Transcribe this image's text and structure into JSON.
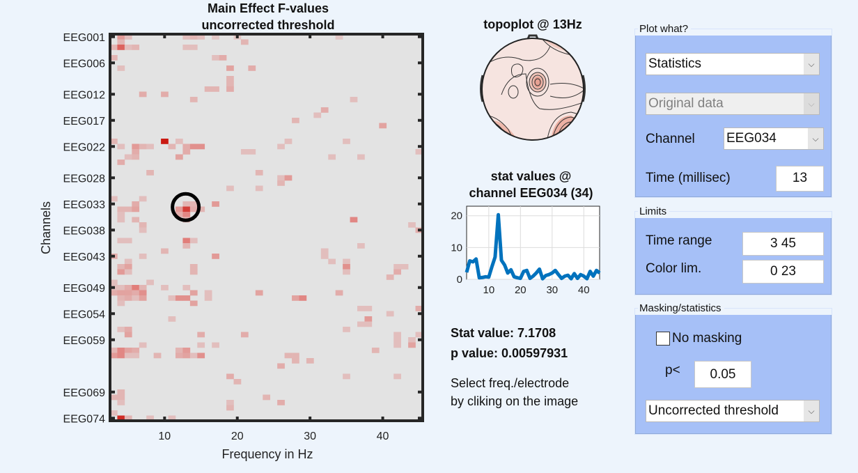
{
  "chart_data": [
    {
      "type": "heatmap",
      "title": "Main Effect F-values",
      "subtitle": "uncorrected threshold",
      "xlabel": "Frequency in Hz",
      "ylabel": "Channels",
      "xlim": [
        3,
        45
      ],
      "x_ticks": [
        10,
        20,
        30,
        40
      ],
      "n_channels": 74,
      "y_tick_labels": [
        {
          "label": "EEG001",
          "channel": 1
        },
        {
          "label": "EEG006",
          "channel": 6
        },
        {
          "label": "EEG012",
          "channel": 12
        },
        {
          "label": "EEG017",
          "channel": 17
        },
        {
          "label": "EEG022",
          "channel": 22
        },
        {
          "label": "EEG028",
          "channel": 28
        },
        {
          "label": "EEG033",
          "channel": 33
        },
        {
          "label": "EEG038",
          "channel": 38
        },
        {
          "label": "EEG043",
          "channel": 43
        },
        {
          "label": "EEG049",
          "channel": 49
        },
        {
          "label": "EEG054",
          "channel": 54
        },
        {
          "label": "EEG059",
          "channel": 59
        },
        {
          "label": "EEG069",
          "channel": 69
        },
        {
          "label": "EEG074",
          "channel": 74
        }
      ],
      "clim": [
        0,
        23
      ],
      "colormap": [
        "#e3e3e3",
        "#c00000"
      ],
      "selected_point": {
        "freq": 13,
        "channel": 34
      },
      "cells_freq_channel_value": [
        [
          4,
          1,
          8
        ],
        [
          5,
          1,
          4
        ],
        [
          13,
          1,
          4
        ],
        [
          14,
          1,
          5
        ],
        [
          15,
          1,
          4
        ],
        [
          17,
          1,
          3
        ],
        [
          20,
          1,
          3
        ],
        [
          34,
          1,
          3
        ],
        [
          4,
          2,
          5
        ],
        [
          21,
          2,
          5
        ],
        [
          3,
          3,
          5
        ],
        [
          4,
          3,
          14
        ],
        [
          5,
          3,
          4
        ],
        [
          6,
          3,
          5
        ],
        [
          13,
          3,
          4
        ],
        [
          14,
          3,
          4
        ],
        [
          3,
          5,
          5
        ],
        [
          17,
          5,
          4
        ],
        [
          18,
          5,
          6
        ],
        [
          4,
          7,
          4
        ],
        [
          19,
          7,
          7
        ],
        [
          22,
          7,
          6
        ],
        [
          19,
          9,
          5
        ],
        [
          19,
          10,
          5
        ],
        [
          16,
          11,
          5
        ],
        [
          17,
          11,
          5
        ],
        [
          19,
          11,
          6
        ],
        [
          7,
          12,
          6
        ],
        [
          10,
          12,
          6
        ],
        [
          14,
          13,
          5
        ],
        [
          36,
          13,
          4
        ],
        [
          32,
          15,
          6
        ],
        [
          31,
          16,
          4
        ],
        [
          28,
          17,
          5
        ],
        [
          40,
          18,
          7
        ],
        [
          3,
          21,
          5
        ],
        [
          10,
          21,
          22
        ],
        [
          12,
          21,
          4
        ],
        [
          27,
          21,
          4
        ],
        [
          35,
          21,
          4
        ],
        [
          4,
          22,
          4
        ],
        [
          6,
          22,
          8
        ],
        [
          7,
          22,
          5
        ],
        [
          8,
          22,
          4
        ],
        [
          11,
          22,
          5
        ],
        [
          13,
          22,
          6
        ],
        [
          14,
          22,
          9
        ],
        [
          15,
          22,
          9
        ],
        [
          26,
          22,
          4
        ],
        [
          6,
          23,
          6
        ],
        [
          13,
          23,
          6
        ],
        [
          21,
          23,
          4
        ],
        [
          22,
          23,
          4
        ],
        [
          45,
          23,
          4
        ],
        [
          5,
          24,
          4
        ],
        [
          6,
          24,
          5
        ],
        [
          12,
          24,
          7
        ],
        [
          33,
          24,
          4
        ],
        [
          37,
          24,
          4
        ],
        [
          4,
          25,
          6
        ],
        [
          8,
          27,
          5
        ],
        [
          23,
          27,
          5
        ],
        [
          26,
          28,
          4
        ],
        [
          27,
          28,
          8
        ],
        [
          26,
          29,
          5
        ],
        [
          19,
          30,
          4
        ],
        [
          23,
          30,
          4
        ],
        [
          3,
          32,
          4
        ],
        [
          7,
          32,
          4
        ],
        [
          6,
          33,
          6
        ],
        [
          13,
          33,
          5
        ],
        [
          14,
          33,
          5
        ],
        [
          17,
          33,
          8
        ],
        [
          4,
          34,
          5
        ],
        [
          5,
          34,
          5
        ],
        [
          6,
          34,
          7
        ],
        [
          12,
          34,
          8
        ],
        [
          13,
          34,
          18
        ],
        [
          14,
          34,
          6
        ],
        [
          15,
          34,
          5
        ],
        [
          4,
          35,
          4
        ],
        [
          12,
          35,
          6
        ],
        [
          13,
          35,
          10
        ],
        [
          4,
          36,
          4
        ],
        [
          6,
          36,
          5
        ],
        [
          13,
          36,
          5
        ],
        [
          36,
          36,
          10
        ],
        [
          7,
          37,
          5
        ],
        [
          44,
          37,
          4
        ],
        [
          7,
          38,
          4
        ],
        [
          45,
          38,
          6
        ],
        [
          4,
          40,
          4
        ],
        [
          5,
          40,
          4
        ],
        [
          13,
          40,
          11
        ],
        [
          14,
          40,
          4
        ],
        [
          13,
          41,
          5
        ],
        [
          37,
          41,
          4
        ],
        [
          10,
          42,
          5
        ],
        [
          32,
          42,
          4
        ],
        [
          3,
          43,
          6
        ],
        [
          7,
          43,
          4
        ],
        [
          17,
          43,
          8
        ],
        [
          32,
          43,
          4
        ],
        [
          5,
          44,
          4
        ],
        [
          33,
          44,
          4
        ],
        [
          35,
          44,
          4
        ],
        [
          4,
          45,
          5
        ],
        [
          5,
          45,
          7
        ],
        [
          14,
          45,
          5
        ],
        [
          35,
          45,
          9
        ],
        [
          42,
          45,
          4
        ],
        [
          43,
          45,
          4
        ],
        [
          4,
          46,
          8
        ],
        [
          5,
          46,
          4
        ],
        [
          14,
          46,
          5
        ],
        [
          35,
          46,
          4
        ],
        [
          42,
          46,
          6
        ],
        [
          41,
          47,
          5
        ],
        [
          3,
          48,
          4
        ],
        [
          8,
          48,
          4
        ],
        [
          3,
          49,
          4
        ],
        [
          4,
          49,
          4
        ],
        [
          5,
          49,
          6
        ],
        [
          6,
          49,
          11
        ],
        [
          7,
          49,
          5
        ],
        [
          10,
          49,
          4
        ],
        [
          13,
          49,
          4
        ],
        [
          3,
          50,
          6
        ],
        [
          4,
          50,
          7
        ],
        [
          5,
          50,
          7
        ],
        [
          6,
          50,
          6
        ],
        [
          7,
          50,
          9
        ],
        [
          14,
          50,
          7
        ],
        [
          16,
          50,
          4
        ],
        [
          23,
          50,
          7
        ],
        [
          34,
          50,
          6
        ],
        [
          4,
          51,
          5
        ],
        [
          5,
          51,
          6
        ],
        [
          6,
          51,
          4
        ],
        [
          7,
          51,
          7
        ],
        [
          11,
          51,
          4
        ],
        [
          12,
          51,
          9
        ],
        [
          13,
          51,
          9
        ],
        [
          16,
          51,
          4
        ],
        [
          28,
          51,
          7
        ],
        [
          29,
          51,
          10
        ],
        [
          4,
          52,
          4
        ],
        [
          14,
          52,
          7
        ],
        [
          37,
          53,
          4
        ],
        [
          38,
          53,
          4
        ],
        [
          45,
          53,
          6
        ],
        [
          41,
          54,
          4
        ],
        [
          11,
          55,
          4
        ],
        [
          38,
          55,
          8
        ],
        [
          37,
          56,
          4
        ],
        [
          38,
          56,
          4
        ],
        [
          4,
          57,
          4
        ],
        [
          5,
          57,
          6
        ],
        [
          35,
          57,
          4
        ],
        [
          5,
          58,
          7
        ],
        [
          15,
          58,
          6
        ],
        [
          21,
          58,
          6
        ],
        [
          42,
          58,
          4
        ],
        [
          45,
          58,
          4
        ],
        [
          42,
          59,
          4
        ],
        [
          44,
          59,
          4
        ],
        [
          7,
          60,
          4
        ],
        [
          15,
          60,
          4
        ],
        [
          17,
          60,
          4
        ],
        [
          42,
          60,
          4
        ],
        [
          44,
          60,
          7
        ],
        [
          3,
          61,
          5
        ],
        [
          4,
          61,
          10
        ],
        [
          5,
          61,
          7
        ],
        [
          6,
          61,
          6
        ],
        [
          12,
          61,
          5
        ],
        [
          13,
          61,
          8
        ],
        [
          39,
          61,
          5
        ],
        [
          3,
          62,
          8
        ],
        [
          4,
          62,
          10
        ],
        [
          5,
          62,
          4
        ],
        [
          6,
          62,
          4
        ],
        [
          9,
          62,
          5
        ],
        [
          12,
          62,
          6
        ],
        [
          13,
          62,
          7
        ],
        [
          14,
          62,
          4
        ],
        [
          15,
          62,
          9
        ],
        [
          27,
          62,
          5
        ],
        [
          28,
          62,
          5
        ],
        [
          28,
          63,
          5
        ],
        [
          30,
          63,
          5
        ],
        [
          26,
          64,
          6
        ],
        [
          19,
          66,
          6
        ],
        [
          35,
          66,
          4
        ],
        [
          42,
          66,
          4
        ],
        [
          20,
          67,
          5
        ],
        [
          4,
          69,
          5
        ],
        [
          3,
          70,
          5
        ],
        [
          4,
          70,
          5
        ],
        [
          24,
          70,
          5
        ],
        [
          4,
          71,
          4
        ],
        [
          19,
          71,
          4
        ],
        [
          26,
          71,
          6
        ],
        [
          19,
          72,
          5
        ],
        [
          3,
          73,
          4
        ],
        [
          4,
          74,
          20
        ],
        [
          5,
          74,
          5
        ],
        [
          8,
          74,
          4
        ],
        [
          11,
          74,
          4
        ]
      ]
    },
    {
      "type": "topoplot",
      "title": "topoplot @ 13Hz"
    },
    {
      "type": "line",
      "title": "stat values @",
      "subtitle": "channel EEG034 (34)",
      "xlim": [
        3,
        45
      ],
      "ylim": [
        0,
        23
      ],
      "x_ticks": [
        10,
        20,
        30,
        40
      ],
      "y_ticks": [
        0,
        10,
        20
      ],
      "grid": true,
      "color": "#0072bd",
      "x": [
        3,
        4,
        5,
        6,
        7,
        8,
        9,
        10,
        11,
        12,
        13,
        14,
        15,
        16,
        17,
        18,
        19,
        20,
        21,
        22,
        23,
        24,
        25,
        26,
        27,
        28,
        29,
        30,
        31,
        32,
        33,
        34,
        35,
        36,
        37,
        38,
        39,
        40,
        41,
        42,
        43,
        44,
        45
      ],
      "y": [
        2.2,
        5.8,
        5.5,
        6.4,
        0.5,
        0.6,
        0.8,
        0.7,
        4.0,
        7.0,
        20.3,
        6.0,
        4.5,
        2.0,
        3.0,
        0.8,
        0.5,
        0.3,
        2.5,
        2.8,
        0.3,
        1.0,
        2.0,
        3.2,
        0.2,
        1.2,
        1.5,
        2.0,
        2.8,
        1.5,
        0.3,
        1.0,
        1.3,
        0.2,
        1.8,
        0.3,
        1.5,
        1.0,
        0.2,
        2.5,
        1.0,
        2.8,
        2.0
      ]
    }
  ],
  "info": {
    "stat_value": "Stat value: 7.1708",
    "p_value": "p value: 0.00597931",
    "hint_line1": "Select freq./electrode",
    "hint_line2": "by cliking on the image"
  },
  "controls": {
    "plot_what": {
      "legend": "Plot what?",
      "type_select": "Statistics",
      "data_select": "Original data",
      "channel_label": "Channel",
      "channel_select": "EEG034",
      "time_label": "Time (millisec)",
      "time_value": "13"
    },
    "limits": {
      "legend": "Limits",
      "time_range_label": "Time range",
      "time_range_value": "3 45",
      "color_lim_label": "Color lim.",
      "color_lim_value": "0 23"
    },
    "masking": {
      "legend": "Masking/statistics",
      "no_masking_label": "No masking",
      "no_masking_checked": false,
      "p_label": "p<",
      "p_value": "0.05",
      "correction_select": "Uncorrected threshold"
    },
    "arrow_glyph": "⌵"
  }
}
